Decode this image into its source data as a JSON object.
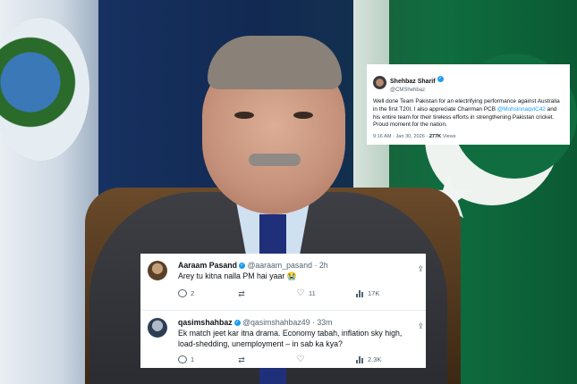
{
  "post": {
    "author_name": "Shehbaz Sharif",
    "author_handle": "@CMShehbaz",
    "text_1": "Well done Team Pakistan for an electrifying performance against Australia in the first T20I. I also appreciate Chairman PCB ",
    "mention": "@MohsinnaqviC42",
    "text_2": " and his entire team for their tireless efforts in strengthening Pakistan cricket. Proud moment for the nation.",
    "time": "9:16 AM · Jan 30, 2026 · ",
    "views": "277K",
    "views_label": " Views"
  },
  "replies": [
    {
      "name": "Aaraam Pasand",
      "handle": "@aaraam_pasand",
      "age": "2h",
      "text": "Arey tu kitna nalla PM hai yaar 😭",
      "stats": {
        "replies": "2",
        "retweets": "",
        "likes": "11",
        "views": "17K"
      }
    },
    {
      "name": "qasimshahbaz",
      "handle": "@qasimshahbaz49",
      "age": "33m",
      "text": "Ek match jeet kar itna drama. Economy tabah, inflation sky high, load-shedding, unemployment – in sab ka kya?",
      "stats": {
        "replies": "1",
        "retweets": "",
        "likes": "",
        "views": "2.3K"
      }
    }
  ],
  "colors": {
    "accent": "#1d9bf0",
    "text": "#0f1419",
    "muted": "#536471"
  },
  "icons": [
    "verified-badge-icon",
    "reply-icon",
    "retweet-icon",
    "like-icon",
    "views-icon",
    "share-icon",
    "crescent-star-flag"
  ]
}
